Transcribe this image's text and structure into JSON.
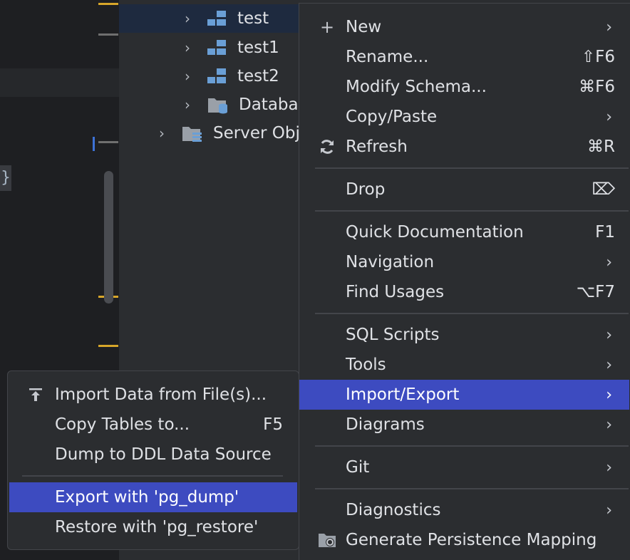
{
  "editor": {
    "brace": "}"
  },
  "tree": {
    "items": [
      {
        "label": "test",
        "icon": "schema-icon"
      },
      {
        "label": "test1",
        "icon": "schema-icon"
      },
      {
        "label": "test2",
        "icon": "schema-icon"
      },
      {
        "label": "Databa",
        "icon": "database-folder-icon"
      },
      {
        "label": "Server Obj",
        "icon": "server-folder-icon"
      }
    ]
  },
  "menu": {
    "items": [
      {
        "label": "New",
        "icon": "plus-icon",
        "submenu": true
      },
      {
        "label": "Rename...",
        "shortcut": "⇧F6"
      },
      {
        "label": "Modify Schema...",
        "shortcut": "⌘F6"
      },
      {
        "label": "Copy/Paste",
        "submenu": true
      },
      {
        "label": "Refresh",
        "icon": "refresh-icon",
        "shortcut": "⌘R"
      },
      {
        "label": "Drop",
        "shortcut": "⌦"
      },
      {
        "label": "Quick Documentation",
        "shortcut": "F1"
      },
      {
        "label": "Navigation",
        "submenu": true
      },
      {
        "label": "Find Usages",
        "shortcut": "⌥F7"
      },
      {
        "label": "SQL Scripts",
        "submenu": true
      },
      {
        "label": "Tools",
        "submenu": true
      },
      {
        "label": "Import/Export",
        "submenu": true,
        "active": true
      },
      {
        "label": "Diagrams",
        "submenu": true
      },
      {
        "label": "Git",
        "submenu": true
      },
      {
        "label": "Diagnostics",
        "submenu": true
      },
      {
        "label": "Generate Persistence Mapping",
        "icon": "persistence-icon"
      }
    ],
    "arrow": "›"
  },
  "submenu": {
    "items": [
      {
        "label": "Import Data from File(s)...",
        "icon": "import-icon"
      },
      {
        "label": "Copy Tables to...",
        "shortcut": "F5"
      },
      {
        "label": "Dump to DDL Data Source"
      },
      {
        "label": "Export with 'pg_dump'",
        "active": true
      },
      {
        "label": "Restore with 'pg_restore'"
      }
    ]
  },
  "colors": {
    "accent": "#3d4bc0",
    "selection": "#1e2a3f",
    "background": "#2b2d30",
    "editor": "#1e1f22"
  }
}
